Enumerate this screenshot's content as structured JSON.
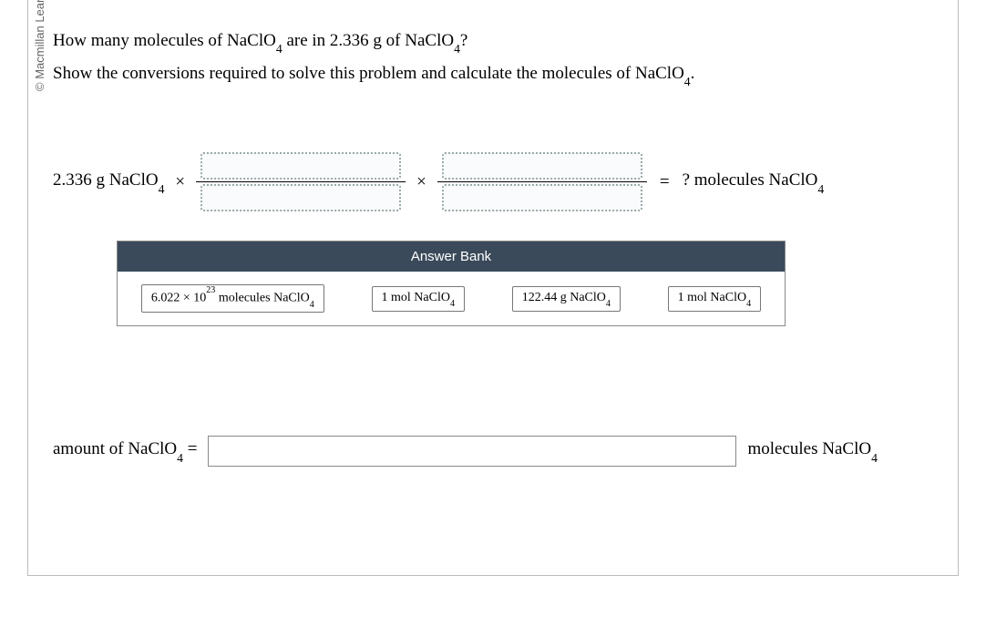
{
  "copyright": "© Macmillan Learning",
  "question": {
    "line1_pre": "How many molecules of NaClO",
    "line1_sub": "4",
    "line1_mid": " are in 2.336 g of NaClO",
    "line1_sub2": "4",
    "line1_post": "?",
    "line2_pre": "Show the conversions required to solve this problem and calculate the molecules of NaClO",
    "line2_sub": "4",
    "line2_post": "."
  },
  "equation": {
    "start_value": "2.336 g NaClO",
    "start_sub": "4",
    "times1": "×",
    "times2": "×",
    "equals": "=",
    "result_prefix": "? molecules NaClO",
    "result_sub": "4"
  },
  "answer_bank": {
    "header": "Answer Bank",
    "tiles": [
      {
        "pre": "6.022 × 10",
        "sup": "23",
        "mid": " molecules NaClO",
        "sub": "4"
      },
      {
        "pre": "1 mol NaClO",
        "sup": "",
        "mid": "",
        "sub": "4"
      },
      {
        "pre": "122.44 g NaClO",
        "sup": "",
        "mid": "",
        "sub": "4"
      },
      {
        "pre": "1 mol NaClO",
        "sup": "",
        "mid": "",
        "sub": "4"
      }
    ]
  },
  "answer": {
    "label_pre": "amount of NaClO",
    "label_sub": "4",
    "label_post": " =",
    "unit_pre": "molecules NaClO",
    "unit_sub": "4",
    "value": ""
  }
}
